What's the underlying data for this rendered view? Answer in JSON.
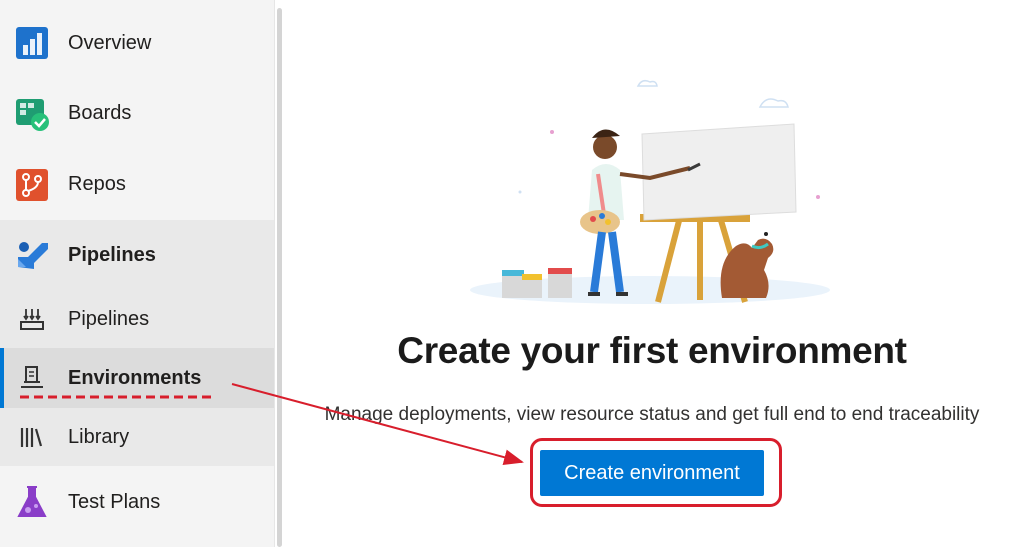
{
  "sidebar": {
    "items": [
      {
        "label": "Overview",
        "icon": "overview-icon"
      },
      {
        "label": "Boards",
        "icon": "boards-icon"
      },
      {
        "label": "Repos",
        "icon": "repos-icon"
      },
      {
        "label": "Pipelines",
        "icon": "pipelines-icon",
        "section": true
      },
      {
        "label": "Pipelines",
        "icon": "pipeline-sub-icon"
      },
      {
        "label": "Environments",
        "icon": "environments-icon",
        "selected": true
      },
      {
        "label": "Library",
        "icon": "library-icon"
      },
      {
        "label": "Test Plans",
        "icon": "test-plans-icon"
      }
    ]
  },
  "main": {
    "title": "Create your first environment",
    "subtitle": "Manage deployments, view resource status and get full end to end traceability",
    "cta_label": "Create environment"
  },
  "colors": {
    "accent": "#0078d4",
    "annotation": "#d81e2c",
    "sidebar_bg": "#f4f4f4"
  }
}
